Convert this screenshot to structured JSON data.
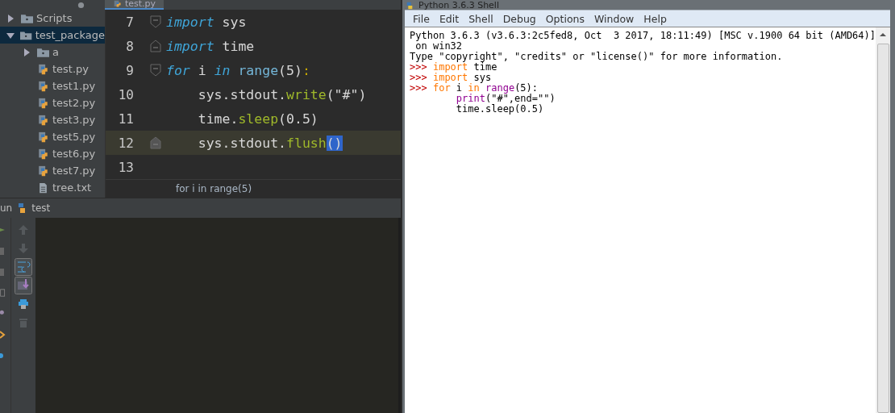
{
  "project_tree": [
    {
      "label": "Scripts",
      "kind": "folder",
      "expanded": false,
      "selected": false
    },
    {
      "label": "test_package",
      "kind": "folder",
      "expanded": true,
      "selected": true,
      "children": [
        {
          "label": "a",
          "kind": "folder",
          "expanded": false,
          "selected": false
        },
        {
          "label": "test.py",
          "kind": "python",
          "selected": false
        },
        {
          "label": "test1.py",
          "kind": "python",
          "selected": false
        },
        {
          "label": "test2.py",
          "kind": "python",
          "selected": false
        },
        {
          "label": "test3.py",
          "kind": "python",
          "selected": false
        },
        {
          "label": "test5.py",
          "kind": "python",
          "selected": false
        },
        {
          "label": "test6.py",
          "kind": "python",
          "selected": false
        },
        {
          "label": "test7.py",
          "kind": "python",
          "selected": false
        },
        {
          "label": "tree.txt",
          "kind": "text",
          "selected": false
        }
      ]
    }
  ],
  "editor": {
    "tab": {
      "label": "test.py"
    },
    "lines": [
      {
        "number": "7",
        "current": false,
        "fold_start": true,
        "tokens": [
          {
            "text": "import",
            "kind": "keyword"
          },
          {
            "text": " sys",
            "kind": "plain"
          }
        ]
      },
      {
        "number": "8",
        "current": false,
        "fold_end": true,
        "tokens": [
          {
            "text": "import",
            "kind": "keyword"
          },
          {
            "text": " time",
            "kind": "plain"
          }
        ]
      },
      {
        "number": "9",
        "current": false,
        "fold_start": true,
        "tokens": [
          {
            "text": "for",
            "kind": "keyword"
          },
          {
            "text": " i ",
            "kind": "plain"
          },
          {
            "text": "in",
            "kind": "keyword"
          },
          {
            "text": " range",
            "kind": "builtin"
          },
          {
            "text": "(5)",
            "kind": "plain"
          },
          {
            "text": ":",
            "kind": "punct"
          }
        ]
      },
      {
        "number": "10",
        "current": false,
        "tokens": [
          {
            "text": "    sys.stdout.",
            "kind": "plain"
          },
          {
            "text": "write",
            "kind": "method"
          },
          {
            "text": "(\"#\")",
            "kind": "plain"
          }
        ]
      },
      {
        "number": "11",
        "current": false,
        "tokens": [
          {
            "text": "    time.",
            "kind": "plain"
          },
          {
            "text": "sleep",
            "kind": "method"
          },
          {
            "text": "(0.5)",
            "kind": "plain"
          }
        ]
      },
      {
        "number": "12",
        "current": true,
        "fold_end": true,
        "tokens": [
          {
            "text": "    sys.stdout.",
            "kind": "plain"
          },
          {
            "text": "flush",
            "kind": "method"
          },
          {
            "text": "()",
            "kind": "match"
          }
        ]
      },
      {
        "number": "13",
        "current": false
      }
    ],
    "breadcrumb": "for i in range(5)"
  },
  "run_panel": {
    "label": "un",
    "config": "test"
  },
  "shell": {
    "title": "Python 3.6.3 Shell",
    "menu": [
      "File",
      "Edit",
      "Shell",
      "Debug",
      "Options",
      "Window",
      "Help"
    ],
    "lines": [
      [
        {
          "text": "Python 3.6.3 (v3.6.3:2c5fed8, Oct  3 2017, 18:11:49) [MSC v.1900 64 bit (AMD64)]",
          "kind": "plain"
        }
      ],
      [
        {
          "text": " on win32",
          "kind": "plain"
        }
      ],
      [
        {
          "text": "Type \"copyright\", \"credits\" or \"license()\" for more information.",
          "kind": "plain"
        }
      ],
      [
        {
          "text": ">>> ",
          "kind": "prompt"
        },
        {
          "text": "import",
          "kind": "keyword"
        },
        {
          "text": " time",
          "kind": "plain"
        }
      ],
      [
        {
          "text": ">>> ",
          "kind": "prompt"
        },
        {
          "text": "import",
          "kind": "keyword"
        },
        {
          "text": " sys",
          "kind": "plain"
        }
      ],
      [
        {
          "text": ">>> ",
          "kind": "prompt"
        },
        {
          "text": "for",
          "kind": "keyword"
        },
        {
          "text": " i ",
          "kind": "plain"
        },
        {
          "text": "in",
          "kind": "keyword"
        },
        {
          "text": " range",
          "kind": "builtin"
        },
        {
          "text": "(5):",
          "kind": "plain"
        }
      ],
      [
        {
          "text": "        print",
          "kind": "builtin"
        },
        {
          "text": "(\"#\",end=\"\")",
          "kind": "plain"
        }
      ],
      [
        {
          "text": "        time.sleep(0.5)",
          "kind": "plain"
        }
      ]
    ]
  }
}
